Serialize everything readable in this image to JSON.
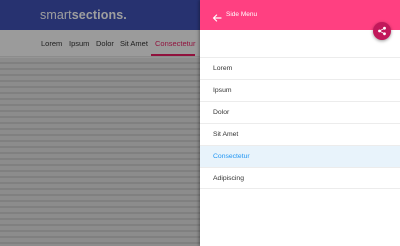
{
  "page": {
    "logo": {
      "light": "smart",
      "bold": "sections."
    },
    "nav_items": [
      {
        "label": "Lorem"
      },
      {
        "label": "Ipsum"
      },
      {
        "label": "Dolor"
      },
      {
        "label": "Sit Amet"
      },
      {
        "label": "Consectetur"
      }
    ],
    "active_nav": "Consectetur"
  },
  "drawer": {
    "title": "Side Menu",
    "back_icon": "arrow-left-icon",
    "share_icon": "share-icon",
    "items": [
      {
        "label": "Lorem"
      },
      {
        "label": "Ipsum"
      },
      {
        "label": "Dolor"
      },
      {
        "label": "Sit Amet"
      },
      {
        "label": "Consectetur"
      },
      {
        "label": "Adipiscing"
      }
    ],
    "active_item": "Consectetur"
  },
  "colors": {
    "primary": "#3f51b5",
    "accent": "#ff4081",
    "accent_dark": "#c2185b",
    "active_text": "#2196f3",
    "active_bg": "#e8f3fb"
  }
}
